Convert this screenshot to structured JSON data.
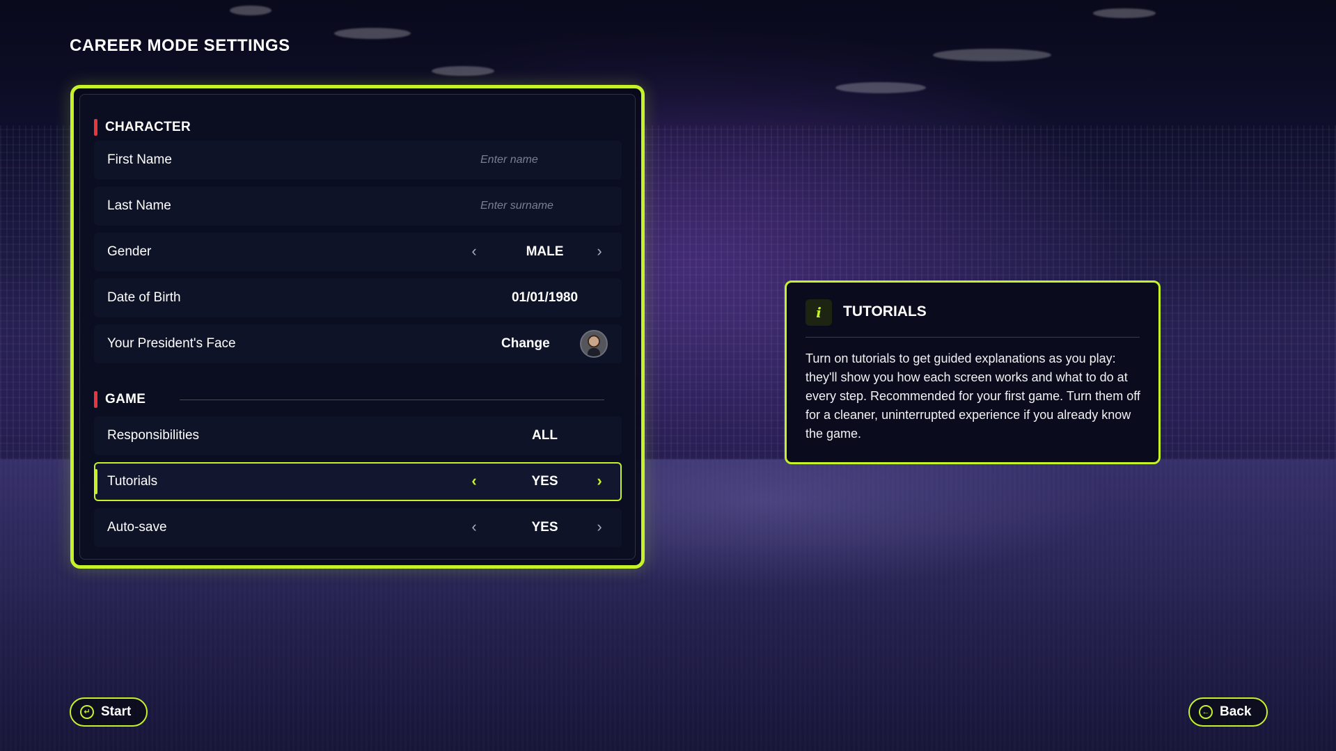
{
  "page": {
    "title": "CAREER MODE SETTINGS"
  },
  "colors": {
    "accent": "#c6f22a",
    "section_marker": "#e8373c",
    "panel_bg": "#0b0e20"
  },
  "sections": {
    "character": {
      "label": "CHARACTER",
      "first_name": {
        "label": "First Name",
        "value": "",
        "placeholder": "Enter name"
      },
      "last_name": {
        "label": "Last Name",
        "value": "",
        "placeholder": "Enter surname"
      },
      "gender": {
        "label": "Gender",
        "value": "MALE"
      },
      "date_of_birth": {
        "label": "Date of Birth",
        "value": "01/01/1980"
      },
      "president_face": {
        "label": "Your President's Face",
        "action": "Change",
        "icon": "avatar"
      }
    },
    "game": {
      "label": "GAME",
      "responsibilities": {
        "label": "Responsibilities",
        "value": "ALL"
      },
      "tutorials": {
        "label": "Tutorials",
        "value": "YES",
        "selected": true
      },
      "autosave": {
        "label": "Auto-save",
        "value": "YES"
      }
    }
  },
  "info_panel": {
    "icon": "info-icon",
    "title": "TUTORIALS",
    "text": "Turn on tutorials to get guided explanations as you play: they'll show you how each screen works and what to do at every step. Recommended for your first game. Turn them off for a cleaner, uninterrupted experience if you already know the game."
  },
  "footer": {
    "start": {
      "label": "Start",
      "icon": "enter-icon"
    },
    "back": {
      "label": "Back",
      "icon": "back-arrow-icon"
    }
  },
  "glyphs": {
    "prev": "‹",
    "next": "›",
    "enter": "↵",
    "back": "←"
  }
}
